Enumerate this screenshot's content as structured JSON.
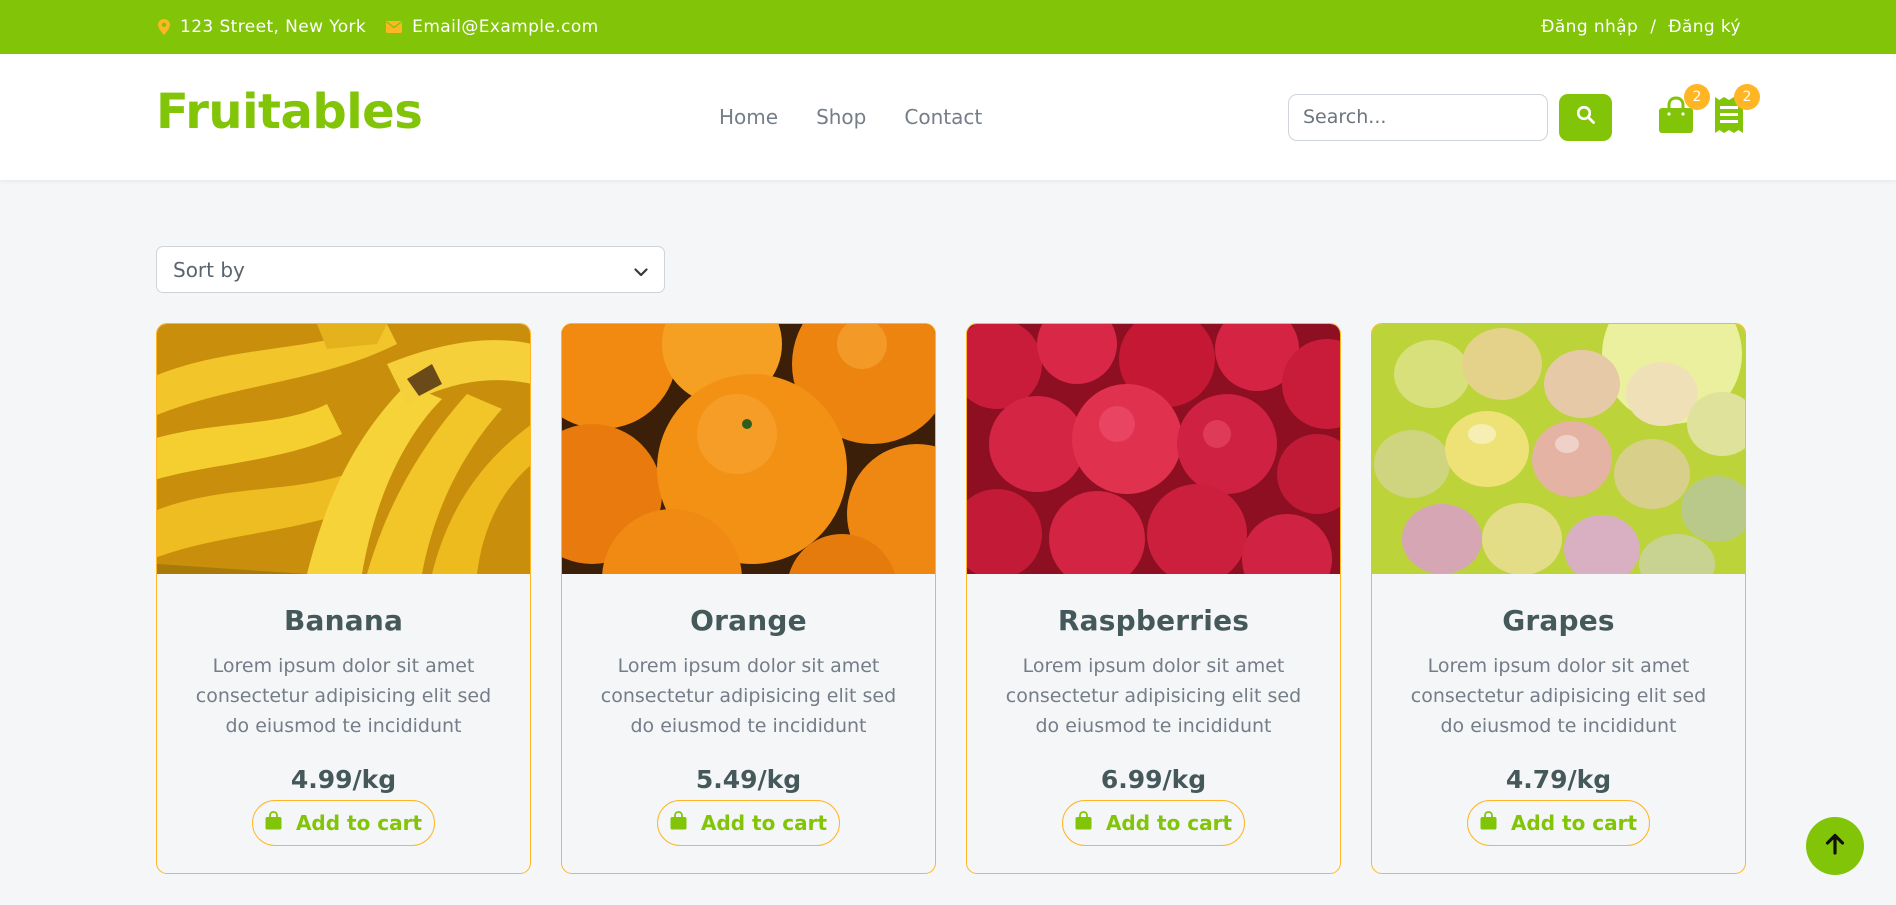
{
  "topbar": {
    "address": "123 Street, New York",
    "email": "Email@Example.com",
    "login": "Đăng nhập",
    "separator": "/",
    "register": "Đăng ký"
  },
  "navbar": {
    "brand": "Fruitables",
    "links": [
      "Home",
      "Shop",
      "Contact"
    ],
    "search_placeholder": "Search...",
    "cart_count": "2",
    "orders_count": "2"
  },
  "sort": {
    "label": "Sort by"
  },
  "products": [
    {
      "name": "Banana",
      "description": "Lorem ipsum dolor sit amet consectetur adipisicing elit sed do eiusmod te incididunt",
      "price": "4.99/kg",
      "button": "Add to cart"
    },
    {
      "name": "Orange",
      "description": "Lorem ipsum dolor sit amet consectetur adipisicing elit sed do eiusmod te incididunt",
      "price": "5.49/kg",
      "button": "Add to cart"
    },
    {
      "name": "Raspberries",
      "description": "Lorem ipsum dolor sit amet consectetur adipisicing elit sed do eiusmod te incididunt",
      "price": "6.99/kg",
      "button": "Add to cart"
    },
    {
      "name": "Grapes",
      "description": "Lorem ipsum dolor sit amet consectetur adipisicing elit sed do eiusmod te incididunt",
      "price": "4.79/kg",
      "button": "Add to cart"
    }
  ],
  "colors": {
    "primary": "#81c408",
    "accent": "#ffb524",
    "text_dark": "#45595b",
    "text_muted": "#747d88"
  },
  "icons": {
    "address": "map-marker-icon",
    "email": "envelope-icon",
    "search": "search-icon",
    "cart": "shopping-bag-icon",
    "orders": "receipt-icon",
    "add": "shopping-bag-icon",
    "back_to_top": "arrow-up-icon",
    "sort": "chevron-down-icon"
  }
}
